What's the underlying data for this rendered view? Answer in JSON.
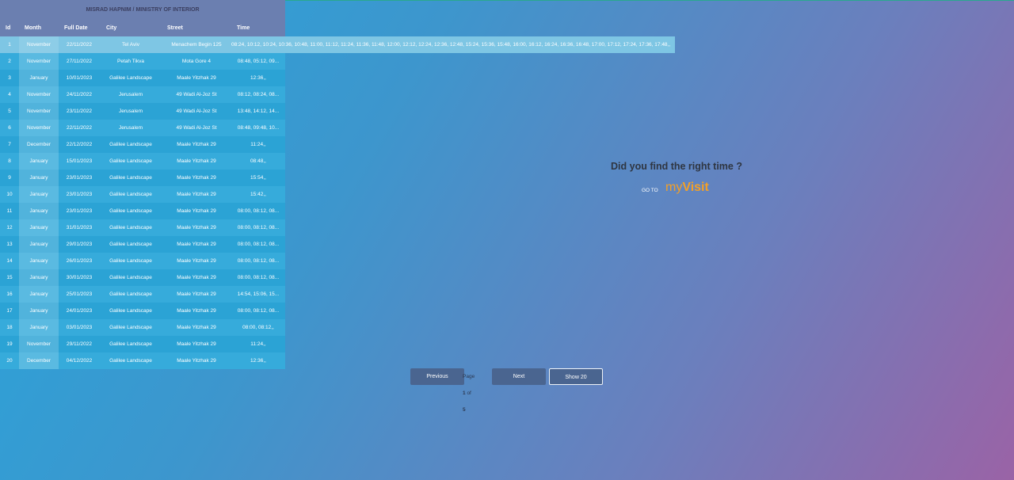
{
  "header": {
    "title": "MISRAD HAPNIM / MINISTRY OF INTERIOR"
  },
  "table": {
    "columns": {
      "id": "Id",
      "month": "Month",
      "full_date": "Full Date",
      "city": "City",
      "street": "Street",
      "time": "Time"
    },
    "rows": [
      {
        "id": "1",
        "month": "November",
        "date": "22/11/2022",
        "city": "Tel Aviv",
        "street": "Menachem Begin 125",
        "time": "08:24, 10:12, 10:24, 10:36, 10:48, 11:00, 11:12, 11:24, 11:36, 11:48, 12:00, 12:12, 12:24, 12:36, 12:48, 15:24, 15:36, 15:48, 16:00, 16:12, 16:24, 16:36, 16:48, 17:00, 17:12, 17:24, 17:36, 17:48,,"
      },
      {
        "id": "2",
        "month": "November",
        "date": "27/11/2022",
        "city": "Petah Tikva",
        "street": "Mota Gore 4",
        "time": "08:48, 05:12, 09..."
      },
      {
        "id": "3",
        "month": "January",
        "date": "10/01/2023",
        "city": "Galilee Landscape",
        "street": "Maale Yitzhak 29",
        "time": "12:36,,"
      },
      {
        "id": "4",
        "month": "November",
        "date": "24/11/2022",
        "city": "Jerusalem",
        "street": "49 Wadi Al-Joz St",
        "time": "08:12, 08:24, 08..."
      },
      {
        "id": "5",
        "month": "November",
        "date": "23/11/2022",
        "city": "Jerusalem",
        "street": "49 Wadi Al-Joz St",
        "time": "13:48, 14:12, 14..."
      },
      {
        "id": "6",
        "month": "November",
        "date": "22/11/2022",
        "city": "Jerusalem",
        "street": "49 Wadi Al-Joz St",
        "time": "08:48, 09:48, 10..."
      },
      {
        "id": "7",
        "month": "December",
        "date": "22/12/2022",
        "city": "Galilee Landscape",
        "street": "Maale Yitzhak 29",
        "time": "11:24,,"
      },
      {
        "id": "8",
        "month": "January",
        "date": "15/01/2023",
        "city": "Galilee Landscape",
        "street": "Maale Yitzhak 29",
        "time": "08:48,,"
      },
      {
        "id": "9",
        "month": "January",
        "date": "23/01/2023",
        "city": "Galilee Landscape",
        "street": "Maale Yitzhak 29",
        "time": "15:54,,"
      },
      {
        "id": "10",
        "month": "January",
        "date": "23/01/2023",
        "city": "Galilee Landscape",
        "street": "Maale Yitzhak 29",
        "time": "15:42,,"
      },
      {
        "id": "11",
        "month": "January",
        "date": "23/01/2023",
        "city": "Galilee Landscape",
        "street": "Maale Yitzhak 29",
        "time": "08:00, 08:12, 08..."
      },
      {
        "id": "12",
        "month": "January",
        "date": "31/01/2023",
        "city": "Galilee Landscape",
        "street": "Maale Yitzhak 29",
        "time": "08:00, 08:12, 08..."
      },
      {
        "id": "13",
        "month": "January",
        "date": "29/01/2023",
        "city": "Galilee Landscape",
        "street": "Maale Yitzhak 29",
        "time": "08:00, 08:12, 08..."
      },
      {
        "id": "14",
        "month": "January",
        "date": "26/01/2023",
        "city": "Galilee Landscape",
        "street": "Maale Yitzhak 29",
        "time": "08:00, 08:12, 08..."
      },
      {
        "id": "15",
        "month": "January",
        "date": "30/01/2023",
        "city": "Galilee Landscape",
        "street": "Maale Yitzhak 29",
        "time": "08:00, 08:12, 08..."
      },
      {
        "id": "16",
        "month": "January",
        "date": "25/01/2023",
        "city": "Galilee Landscape",
        "street": "Maale Yitzhak 29",
        "time": "14:54, 15:06, 15..."
      },
      {
        "id": "17",
        "month": "January",
        "date": "24/01/2023",
        "city": "Galilee Landscape",
        "street": "Maale Yitzhak 29",
        "time": "08:00, 08:12, 08..."
      },
      {
        "id": "18",
        "month": "January",
        "date": "03/01/2023",
        "city": "Galilee Landscape",
        "street": "Maale Yitzhak 29",
        "time": "08:00, 08:12,,"
      },
      {
        "id": "19",
        "month": "November",
        "date": "29/11/2022",
        "city": "Galilee Landscape",
        "street": "Maale Yitzhak 29",
        "time": "11:24,,"
      },
      {
        "id": "20",
        "month": "December",
        "date": "04/12/2022",
        "city": "Galilee Landscape",
        "street": "Maale Yitzhak 29",
        "time": "12:36,,"
      }
    ]
  },
  "promo": {
    "question": "Did you find the right time ?",
    "goto": "GO TO",
    "brand_prefix": "my",
    "brand_suffix": "Visit"
  },
  "pagination": {
    "previous": "Previous",
    "page_label": "Page",
    "current_page": "1",
    "of_label": "of",
    "total_pages": "5",
    "next": "Next",
    "show": "Show 20"
  },
  "colors": {
    "brand": "#f4a026",
    "header_bg": "#6b7fb0",
    "button_bg": "#4a6590"
  }
}
